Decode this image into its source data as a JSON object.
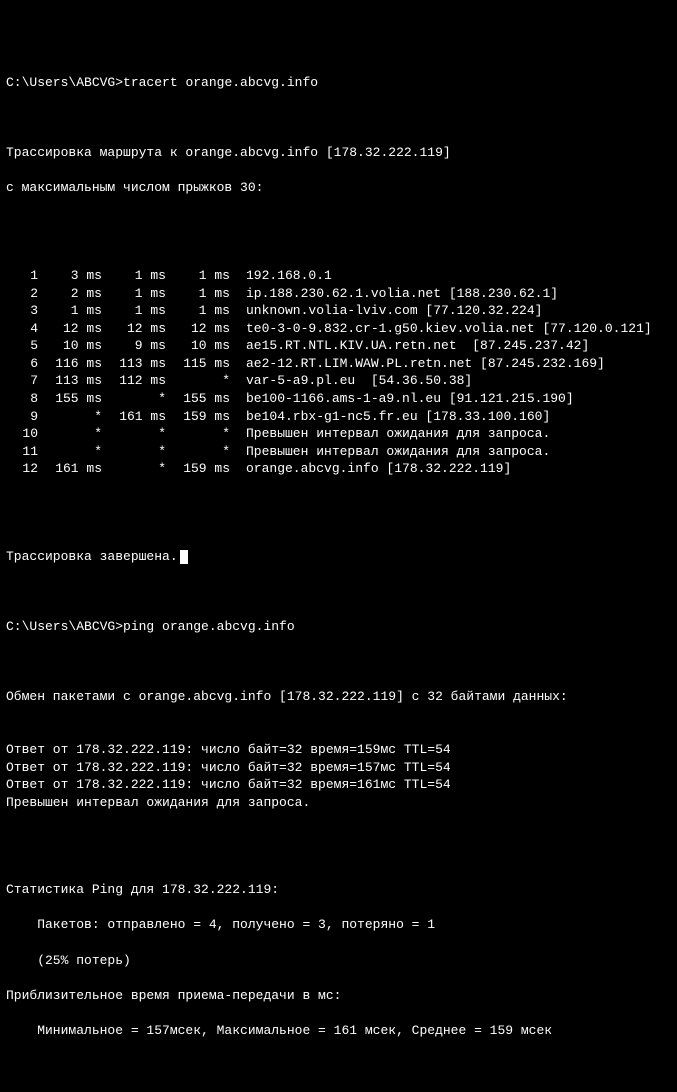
{
  "prompt_path": "C:\\Users\\ABCVG>",
  "cmd_tracert": "tracert orange.abcvg.info",
  "cmd_ping": "ping orange.abcvg.info",
  "trace_header1": "Трассировка маршрута к orange.abcvg.info [178.32.222.119]",
  "trace_header2": "с максимальным числом прыжков 30:",
  "hops": [
    {
      "n": "1",
      "t1": "3 ms",
      "t2": "1 ms",
      "t3": "1 ms",
      "host": "192.168.0.1"
    },
    {
      "n": "2",
      "t1": "2 ms",
      "t2": "1 ms",
      "t3": "1 ms",
      "host": "ip.188.230.62.1.volia.net [188.230.62.1]"
    },
    {
      "n": "3",
      "t1": "1 ms",
      "t2": "1 ms",
      "t3": "1 ms",
      "host": "unknown.volia-lviv.com [77.120.32.224]"
    },
    {
      "n": "4",
      "t1": "12 ms",
      "t2": "12 ms",
      "t3": "12 ms",
      "host": "te0-3-0-9.832.cr-1.g50.kiev.volia.net [77.120.0.121]"
    },
    {
      "n": "5",
      "t1": "10 ms",
      "t2": "9 ms",
      "t3": "10 ms",
      "host": "ae15.RT.NTL.KIV.UA.retn.net  [87.245.237.42]"
    },
    {
      "n": "6",
      "t1": "116 ms",
      "t2": "113 ms",
      "t3": "115 ms",
      "host": "ae2-12.RT.LIM.WAW.PL.retn.net [87.245.232.169]"
    },
    {
      "n": "7",
      "t1": "113 ms",
      "t2": "112 ms",
      "t3": "*",
      "host": "var-5-a9.pl.eu  [54.36.50.38]"
    },
    {
      "n": "8",
      "t1": "155 ms",
      "t2": "*",
      "t3": "155 ms",
      "host": "be100-1166.ams-1-a9.nl.eu [91.121.215.190]"
    },
    {
      "n": "9",
      "t1": "*",
      "t2": "161 ms",
      "t3": "159 ms",
      "host": "be104.rbx-g1-nc5.fr.eu [178.33.100.160]"
    },
    {
      "n": "10",
      "t1": "*",
      "t2": "*",
      "t3": "*",
      "host": "Превышен интервал ожидания для запроса."
    },
    {
      "n": "11",
      "t1": "*",
      "t2": "*",
      "t3": "*",
      "host": "Превышен интервал ожидания для запроса."
    },
    {
      "n": "12",
      "t1": "161 ms",
      "t2": "*",
      "t3": "159 ms",
      "host": "orange.abcvg.info [178.32.222.119]"
    }
  ],
  "trace_done": "Трассировка завершена.",
  "ping_header": "Обмен пакетами с orange.abcvg.info [178.32.222.119] с 32 байтами данных:",
  "ping_replies": [
    "Ответ от 178.32.222.119: число байт=32 время=159мс TTL=54",
    "Ответ от 178.32.222.119: число байт=32 время=157мс TTL=54",
    "Ответ от 178.32.222.119: число байт=32 время=161мс TTL=54",
    "Превышен интервал ожидания для запроса."
  ],
  "ping_stats_header": "Статистика Ping для 178.32.222.119:",
  "ping_stats_packets": "    Пакетов: отправлено = 4, получено = 3, потеряно = 1",
  "ping_stats_loss": "    (25% потерь)",
  "ping_time_header": "Приблизительное время приема-передачи в мс:",
  "ping_time_stats": "    Минимальное = 157мсек, Максимальное = 161 мсек, Среднее = 159 мсек"
}
